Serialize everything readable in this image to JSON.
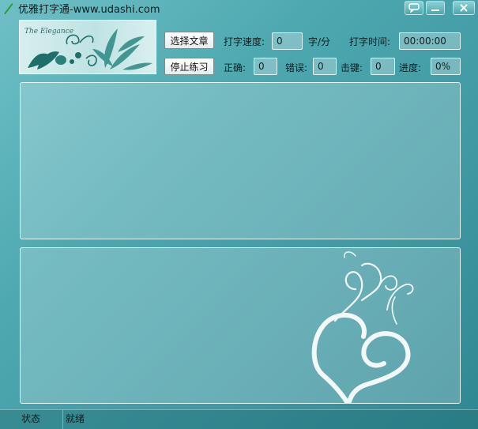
{
  "window": {
    "title": "优雅打字通-www.udashi.com",
    "controls": [
      "chat-icon",
      "minimize-icon",
      "close-icon"
    ]
  },
  "banner": {
    "signature": "The Elegance"
  },
  "toolbar": {
    "select_article": "选择文章",
    "stop_practice": "停止练习",
    "speed_label": "打字速度:",
    "speed_value": "0",
    "speed_unit": "字/分",
    "time_label": "打字时间:",
    "time_value": "00:00:00",
    "correct_label": "正确:",
    "correct_value": "0",
    "errors_label": "错误:",
    "errors_value": "0",
    "keystrokes_label": "击键:",
    "keystrokes_value": "0",
    "progress_label": "进度:",
    "progress_value": "0%"
  },
  "status": {
    "label": "状态",
    "value": "就绪"
  },
  "colors": {
    "background": "#4ea8b0",
    "panel_border": "#eaf7f7",
    "title_text": "#0b1d1f"
  }
}
